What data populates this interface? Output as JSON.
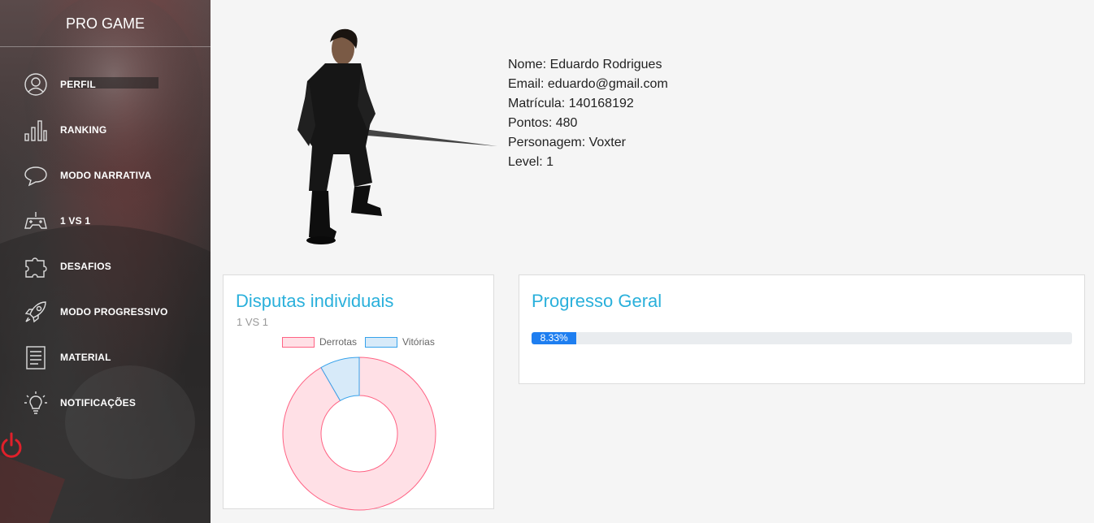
{
  "app": {
    "brand": "PRO GAME"
  },
  "sidebar": {
    "items": [
      {
        "label": "PERFIL",
        "icon": "user-icon"
      },
      {
        "label": "RANKING",
        "icon": "bar-chart-icon"
      },
      {
        "label": "MODO NARRATIVA",
        "icon": "speech-bubble-icon"
      },
      {
        "label": "1 VS 1",
        "icon": "gamepad-icon"
      },
      {
        "label": "DESAFIOS",
        "icon": "puzzle-icon"
      },
      {
        "label": "MODO PROGRESSIVO",
        "icon": "rocket-icon"
      },
      {
        "label": "MATERIAL",
        "icon": "document-icon"
      },
      {
        "label": "NOTIFICAÇÕES",
        "icon": "lightbulb-icon"
      }
    ],
    "logout_icon": "power-icon",
    "logout_color": "#e0202a"
  },
  "profile": {
    "nome": "Nome: Eduardo Rodrigues",
    "email": "Email: eduardo@gmail.com",
    "matricula": "Matrícula: 140168192",
    "pontos": "Pontos: 480",
    "personagem": "Personagem: Voxter",
    "level": "Level: 1"
  },
  "disputas": {
    "title": "Disputas individuais",
    "subtitle": "1 VS 1",
    "chart_data": {
      "type": "pie",
      "categories": [
        "Derrotas",
        "Vitórias"
      ],
      "values": [
        11,
        1
      ],
      "colors": [
        "#ffe0e6",
        "#d7eaf9"
      ],
      "borders": [
        "#ff6384",
        "#36a2eb"
      ],
      "legend": "top"
    }
  },
  "progresso": {
    "title": "Progresso Geral",
    "value": 8.33,
    "label": "8.33%"
  }
}
